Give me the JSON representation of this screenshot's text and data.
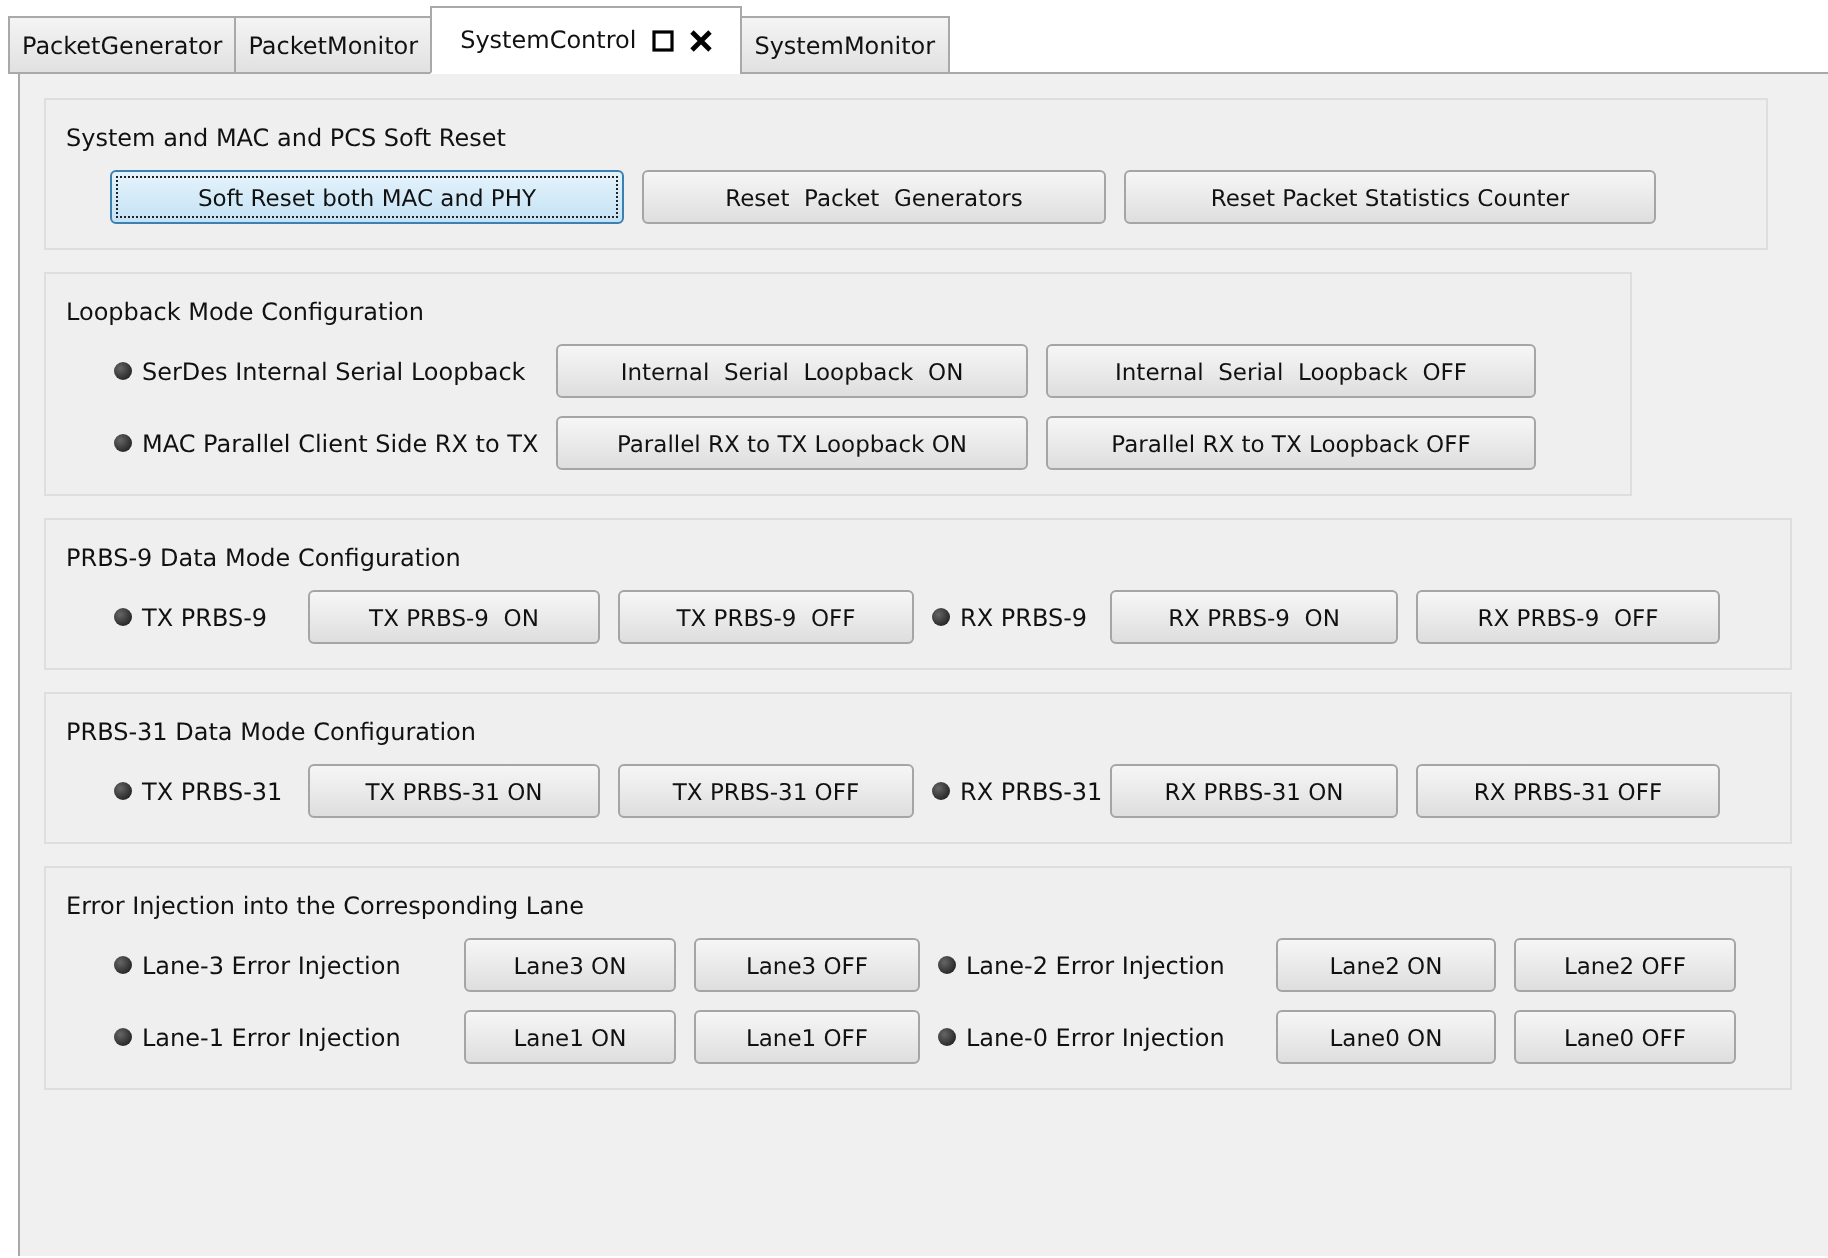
{
  "tabs": [
    {
      "label": "PacketGenerator",
      "selected": false
    },
    {
      "label": "PacketMonitor",
      "selected": false
    },
    {
      "label": "SystemControl",
      "selected": true
    },
    {
      "label": "SystemMonitor",
      "selected": false
    }
  ],
  "groups": [
    {
      "title": "System and MAC and PCS Soft Reset",
      "rows": [
        [
          {
            "kind": "button",
            "label": "Soft Reset both MAC and PHY",
            "focused": true
          },
          {
            "kind": "button",
            "label": "Reset  Packet  Generators",
            "focused": false
          },
          {
            "kind": "button",
            "label": "Reset Packet Statistics Counter",
            "focused": false
          }
        ]
      ]
    },
    {
      "title": "Loopback Mode Configuration",
      "rows": [
        [
          {
            "kind": "status",
            "label": "SerDes Internal Serial Loopback"
          },
          {
            "kind": "button",
            "label": "Internal  Serial  Loopback  ON",
            "focused": false
          },
          {
            "kind": "button",
            "label": "Internal  Serial  Loopback  OFF",
            "focused": false
          }
        ],
        [
          {
            "kind": "status",
            "label": "MAC Parallel Client Side RX to TX"
          },
          {
            "kind": "button",
            "label": "Parallel RX to TX Loopback ON",
            "focused": false
          },
          {
            "kind": "button",
            "label": "Parallel RX to TX Loopback OFF",
            "focused": false
          }
        ]
      ]
    },
    {
      "title": "PRBS-9  Data Mode Configuration",
      "rows": [
        [
          {
            "kind": "status",
            "label": "TX PRBS-9"
          },
          {
            "kind": "button",
            "label": "TX PRBS-9  ON",
            "focused": false
          },
          {
            "kind": "button",
            "label": "TX PRBS-9  OFF",
            "focused": false
          },
          {
            "kind": "status",
            "label": "RX PRBS-9"
          },
          {
            "kind": "button",
            "label": "RX PRBS-9  ON",
            "focused": false
          },
          {
            "kind": "button",
            "label": "RX PRBS-9  OFF",
            "focused": false
          }
        ]
      ]
    },
    {
      "title": "PRBS-31 Data Mode Configuration",
      "rows": [
        [
          {
            "kind": "status",
            "label": "TX PRBS-31"
          },
          {
            "kind": "button",
            "label": "TX PRBS-31 ON",
            "focused": false
          },
          {
            "kind": "button",
            "label": "TX PRBS-31 OFF",
            "focused": false
          },
          {
            "kind": "status",
            "label": "RX PRBS-31"
          },
          {
            "kind": "button",
            "label": "RX PRBS-31 ON",
            "focused": false
          },
          {
            "kind": "button",
            "label": "RX PRBS-31 OFF",
            "focused": false
          }
        ]
      ]
    },
    {
      "title": "Error Injection into the Corresponding Lane",
      "rows": [
        [
          {
            "kind": "status",
            "label": "Lane-3 Error Injection"
          },
          {
            "kind": "button",
            "label": "Lane3 ON",
            "focused": false
          },
          {
            "kind": "button",
            "label": "Lane3 OFF",
            "focused": false
          },
          {
            "kind": "status",
            "label": "Lane-2 Error Injection"
          },
          {
            "kind": "button",
            "label": "Lane2 ON",
            "focused": false
          },
          {
            "kind": "button",
            "label": "Lane2 OFF",
            "focused": false
          }
        ],
        [
          {
            "kind": "status",
            "label": "Lane-1 Error Injection"
          },
          {
            "kind": "button",
            "label": "Lane1 ON",
            "focused": false
          },
          {
            "kind": "button",
            "label": "Lane1 OFF",
            "focused": false
          },
          {
            "kind": "status",
            "label": "Lane-0 Error Injection"
          },
          {
            "kind": "button",
            "label": "Lane0 ON",
            "focused": false
          },
          {
            "kind": "button",
            "label": "Lane0 OFF",
            "focused": false
          }
        ]
      ]
    }
  ]
}
